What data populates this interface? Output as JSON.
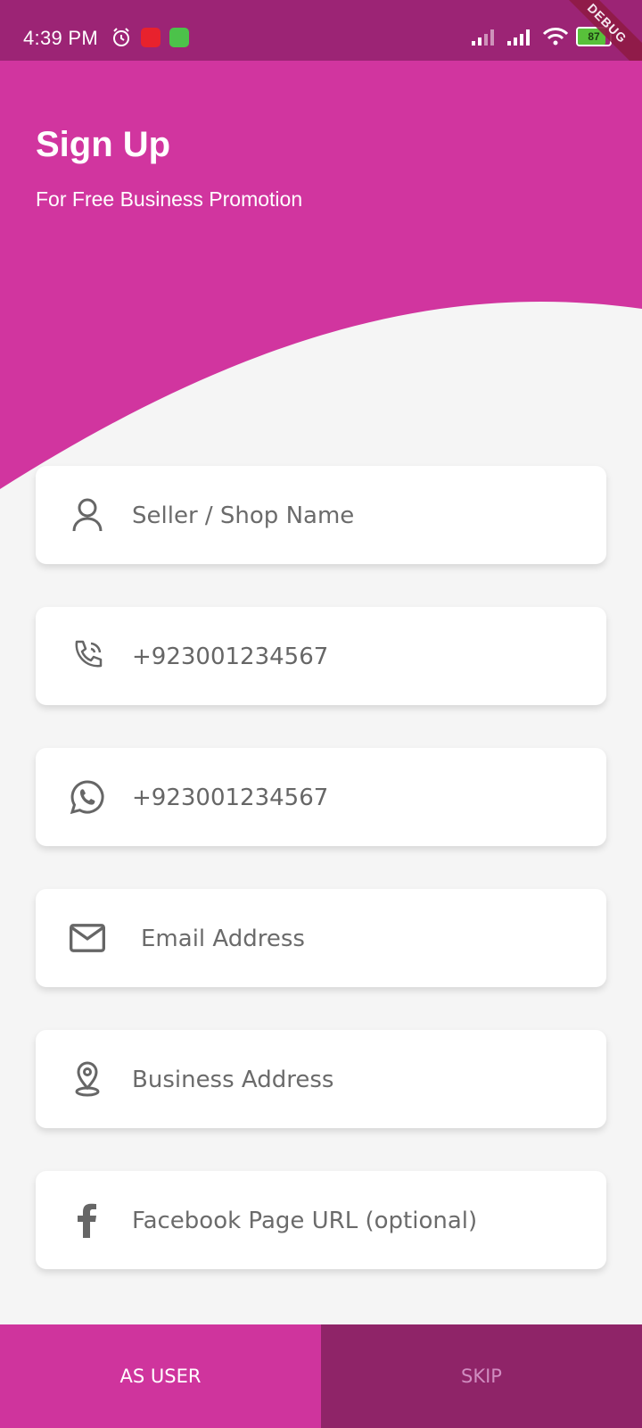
{
  "status_bar": {
    "time": "4:39 PM",
    "battery": "87",
    "debug": "DEBUG"
  },
  "header": {
    "title": "Sign Up",
    "subtitle": "For Free Business Promotion",
    "accent": "#d1359f"
  },
  "form": {
    "shop_name_placeholder": "Seller / Shop Name",
    "phone_value": "+923001234567",
    "whatsapp_value": "+923001234567",
    "email_placeholder": "Email Address",
    "address_placeholder": "Business Address",
    "facebook_placeholder": "Facebook Page URL (optional)"
  },
  "buttons": {
    "as_user": "AS USER",
    "skip": "SKIP"
  }
}
